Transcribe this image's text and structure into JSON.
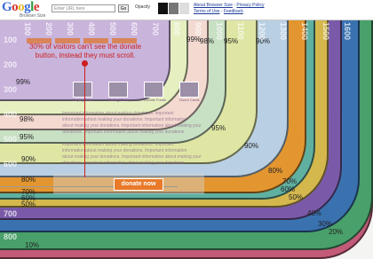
{
  "toolbar": {
    "logo_letters": [
      "G",
      "o",
      "o",
      "g",
      "l",
      "e"
    ],
    "logo_colors": [
      "#3b6bd6",
      "#d8332a",
      "#e9b82a",
      "#3b6bd6",
      "#2f9a3d",
      "#d8332a"
    ],
    "logo_subtitle": "Browser Size",
    "url_placeholder": "Enter URL here",
    "go_label": "Go",
    "opacity_label": "Opacity",
    "links": [
      "About Browser Size",
      "Privacy Policy",
      "Terms of Use",
      "Feedback"
    ]
  },
  "callout": "30% of visitors can't see the donate button, instead they must scroll.",
  "donate_label": "donate now",
  "page_text_lines": [
    "Important information about making donations. Important",
    "information about making your donations. Important information",
    "about making your donations. Important information about making your",
    "donations. Important information about making your donations."
  ],
  "thumb_labels": [
    "Buying Gifts",
    "Saving Money",
    "Donate Funds",
    "Donor Cards"
  ],
  "percentages": [
    {
      "label": "99%",
      "key": "p99a"
    },
    {
      "label": "99%",
      "key": "p99b"
    },
    {
      "label": "98%",
      "key": "p98a"
    },
    {
      "label": "98%",
      "key": "p98b"
    },
    {
      "label": "95%",
      "key": "p95a"
    },
    {
      "label": "95%",
      "key": "p95b"
    },
    {
      "label": "95%",
      "key": "p95c"
    },
    {
      "label": "90%",
      "key": "p90a"
    },
    {
      "label": "90%",
      "key": "p90b"
    },
    {
      "label": "90%",
      "key": "p90c"
    },
    {
      "label": "80%",
      "key": "p80a"
    },
    {
      "label": "80%",
      "key": "p80b"
    },
    {
      "label": "70%",
      "key": "p70a"
    },
    {
      "label": "70%",
      "key": "p70b"
    },
    {
      "label": "60%",
      "key": "p60a"
    },
    {
      "label": "60%",
      "key": "p60b"
    },
    {
      "label": "50%",
      "key": "p50a"
    },
    {
      "label": "50%",
      "key": "p50b"
    },
    {
      "label": "40%",
      "key": "p40a"
    },
    {
      "label": "30%",
      "key": "p30a"
    },
    {
      "label": "20%",
      "key": "p20a"
    },
    {
      "label": "10%",
      "key": "p10a"
    }
  ],
  "row_labels": [
    "100",
    "200",
    "300",
    "400",
    "500",
    "600",
    "700",
    "800"
  ],
  "col_labels": [
    "100",
    "200",
    "300",
    "400",
    "500",
    "600",
    "700",
    "800",
    "900",
    "1000",
    "1100",
    "1200",
    "1300",
    "1400",
    "1500",
    "1600"
  ],
  "band_colors": [
    "#c25a78",
    "#49a06a",
    "#3a72b0",
    "#7a5aa8",
    "#d4b84e",
    "#5fb0a0",
    "#d07a45",
    "#b9cfe3",
    "#dfe6a4",
    "#c8e0c4",
    "#d9c8e6",
    "#f3d9d0",
    "#e6efc0",
    "#c9b4dc"
  ]
}
